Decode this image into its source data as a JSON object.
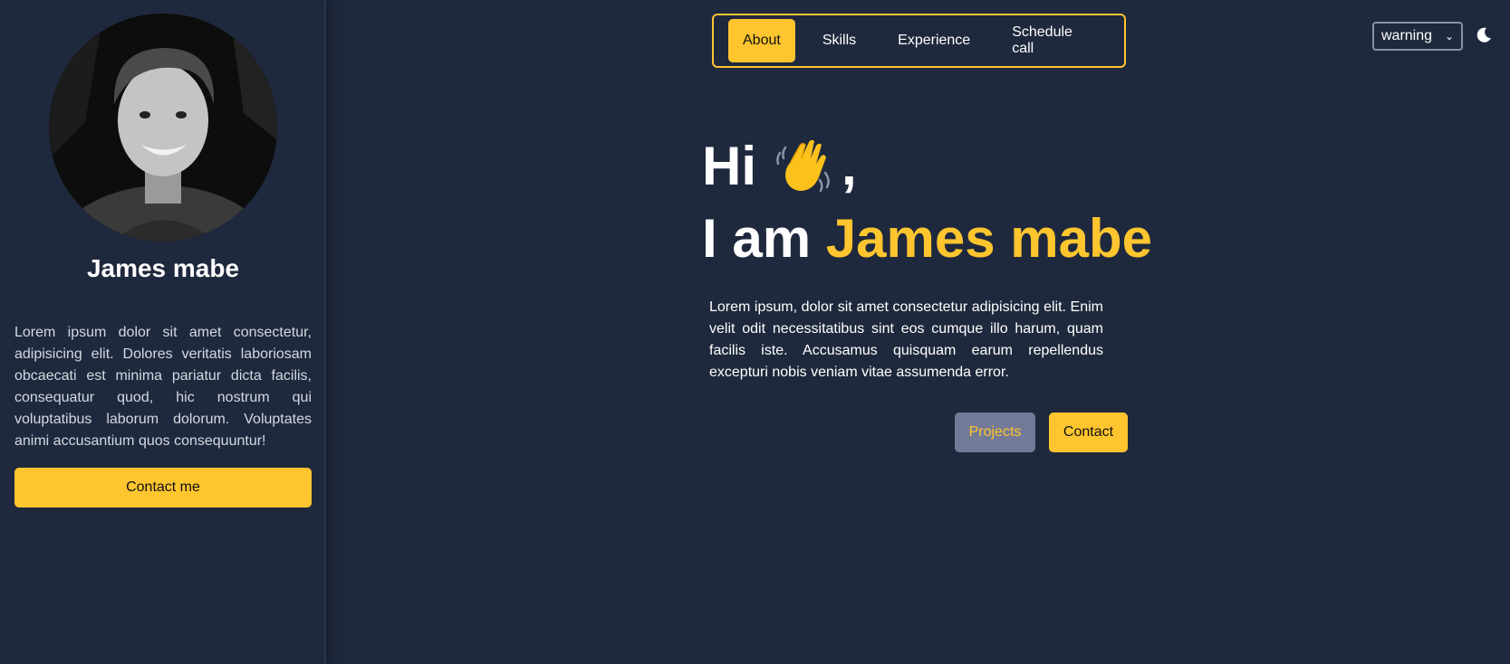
{
  "sidebar": {
    "avatar_icon": "profile-photo",
    "name": "James mabe",
    "bio": "Lorem ipsum dolor sit amet consectetur, adipisicing elit. Dolores veritatis laboriosam obcaecati est minima pariatur dicta facilis, consequatur quod, hic nostrum qui voluptatibus laborum dolorum. Voluptates animi accusantium quos consequuntur!",
    "contact_label": "Contact me"
  },
  "nav": {
    "items": [
      {
        "label": "About",
        "active": true
      },
      {
        "label": "Skills",
        "active": false
      },
      {
        "label": "Experience",
        "active": false
      },
      {
        "label": "Schedule call",
        "active": false
      }
    ]
  },
  "controls": {
    "theme_select_value": "warning",
    "dark_mode_icon": "moon-icon"
  },
  "hero": {
    "greeting": "Hi",
    "greeting_icon": "waving-hand-icon",
    "greeting_suffix": ",",
    "prefix": "I am ",
    "name": "James mabe",
    "intro": "Lorem ipsum, dolor sit amet consectetur adipisicing elit. Enim velit odit necessitatibus sint eos cumque illo harum, quam facilis iste. Accusamus quisquam earum repellendus excepturi nobis veniam vitae assumenda error.",
    "projects_label": "Projects",
    "contact_label": "Contact"
  },
  "colors": {
    "background": "#1f293d",
    "accent": "#fec52f",
    "secondary_button": "#737a98"
  }
}
